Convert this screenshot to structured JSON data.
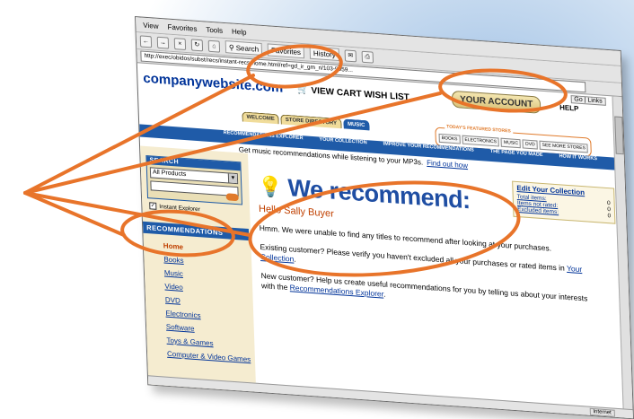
{
  "browser": {
    "menu": [
      "View",
      "Favorites",
      "Tools",
      "Help"
    ],
    "toolbar": {
      "search_label": "Search",
      "favorites_label": "Favorites",
      "history_label": "History"
    },
    "address": "http://exec/obidos/subst/recs/instant-recs-home.html/ref=gd_ir_gm_ri/103-9959..."
  },
  "header": {
    "logo": "companywebsite.com",
    "view_cart": "VIEW CART",
    "wish_list": "WISH LIST",
    "your_account": "YOUR ACCOUNT",
    "help": "HELP",
    "go_label": "Go",
    "links_label": "Links"
  },
  "tabs": [
    "WELCOME",
    "STORE DIRECTORY",
    "MUSIC"
  ],
  "featured_stores": {
    "label": "TODAY'S FEATURED STORES",
    "items": [
      "BOOKS",
      "ELECTRONICS",
      "MUSIC",
      "DVD",
      "SEE MORE STORES"
    ]
  },
  "navbar": [
    "RECOMMENDATIONS EXPLORER",
    "YOUR COLLECTION",
    "IMPROVE YOUR RECOMMENDATIONS",
    "THE PAGE YOU MADE",
    "HOW IT WORKS"
  ],
  "promo": {
    "text": "Get music recommendations while listening to your MP3s.",
    "link": "Find out how"
  },
  "search": {
    "heading": "SEARCH",
    "selected": "All Products",
    "checkbox_label": "Instant Explorer"
  },
  "recommendations": {
    "heading": "RECOMMENDATIONS",
    "items": [
      "Home",
      "Books",
      "Music",
      "Video",
      "DVD",
      "Electronics",
      "Software",
      "Toys & Games",
      "Computer & Video Games"
    ]
  },
  "main": {
    "title": "We recommend:",
    "greeting": "Hello Sally Buyer",
    "p1_text": "Hmm. We were unable to find any titles to recommend after looking at your purchases.",
    "p2_text": "Existing customer? Please verify you haven't excluded all your purchases or rated items in",
    "p2_link": "Your Collection",
    "p3_text": "New customer? Help us create useful recommendations for you by telling us about your interests with the",
    "p3_link": "Recommendations Explorer"
  },
  "collection": {
    "heading": "Edit Your Collection",
    "rows": [
      {
        "label": "Total items:",
        "value": "0"
      },
      {
        "label": "Items not rated:",
        "value": "0"
      },
      {
        "label": "Excluded items:",
        "value": "0"
      }
    ]
  },
  "statusbar": {
    "zone": "Internet"
  },
  "colors": {
    "brand_blue": "#1f5ba8",
    "annotation": "#e8742a",
    "link": "#003399"
  }
}
